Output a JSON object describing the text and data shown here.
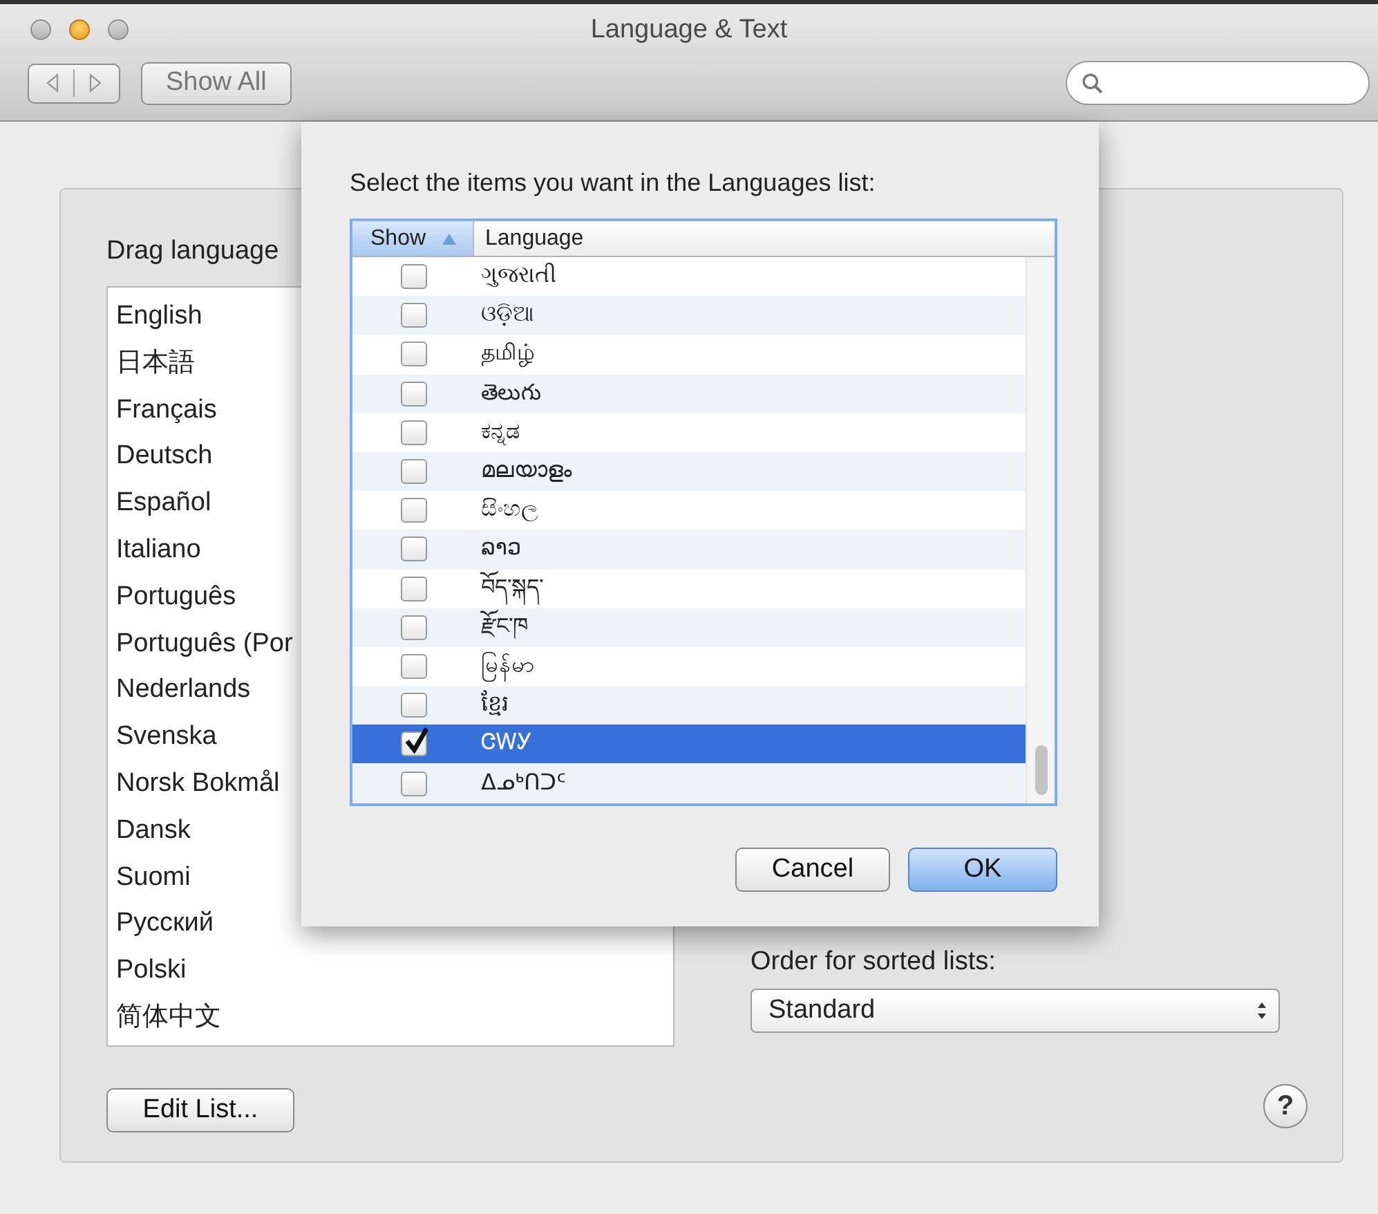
{
  "window": {
    "title": "Language & Text"
  },
  "toolbar": {
    "show_all": "Show All"
  },
  "panel": {
    "drag_label": "Drag language",
    "languages": [
      "English",
      "日本語",
      "Français",
      "Deutsch",
      "Español",
      "Italiano",
      "Português",
      "Português (Por",
      "Nederlands",
      "Svenska",
      "Norsk Bokmål",
      "Dansk",
      "Suomi",
      "Русский",
      "Polski",
      "简体中文"
    ],
    "edit_list": "Edit List...",
    "order_label": "Order for sorted lists:",
    "order_value": "Standard",
    "help": "?"
  },
  "sheet": {
    "prompt": "Select the items you want in the Languages list:",
    "columns": [
      {
        "label": "Show",
        "sorted": true
      },
      {
        "label": "Language",
        "sorted": false
      }
    ],
    "rows": [
      {
        "name": "ગુજરાતી",
        "checked": false,
        "selected": false
      },
      {
        "name": "ଓଡ଼ିଆ",
        "checked": false,
        "selected": false
      },
      {
        "name": "தமிழ்",
        "checked": false,
        "selected": false
      },
      {
        "name": "తెలుగు",
        "checked": false,
        "selected": false
      },
      {
        "name": "ಕನ್ನಡ",
        "checked": false,
        "selected": false
      },
      {
        "name": "മലയാളം",
        "checked": false,
        "selected": false
      },
      {
        "name": "සිංහල",
        "checked": false,
        "selected": false
      },
      {
        "name": "ລາວ",
        "checked": false,
        "selected": false
      },
      {
        "name": "བོད་སྐད་",
        "checked": false,
        "selected": false
      },
      {
        "name": "རྫོང་ཁ",
        "checked": false,
        "selected": false
      },
      {
        "name": "မြန်မာ",
        "checked": false,
        "selected": false
      },
      {
        "name": "ខ្មែរ",
        "checked": false,
        "selected": false
      },
      {
        "name": "ᏣᎳᎩ",
        "checked": true,
        "selected": true
      },
      {
        "name": "ᐃᓄᒃᑎᑐᑦ",
        "checked": false,
        "selected": false
      }
    ],
    "buttons": [
      {
        "label": "Cancel",
        "default": false
      },
      {
        "label": "OK",
        "default": true
      }
    ]
  }
}
